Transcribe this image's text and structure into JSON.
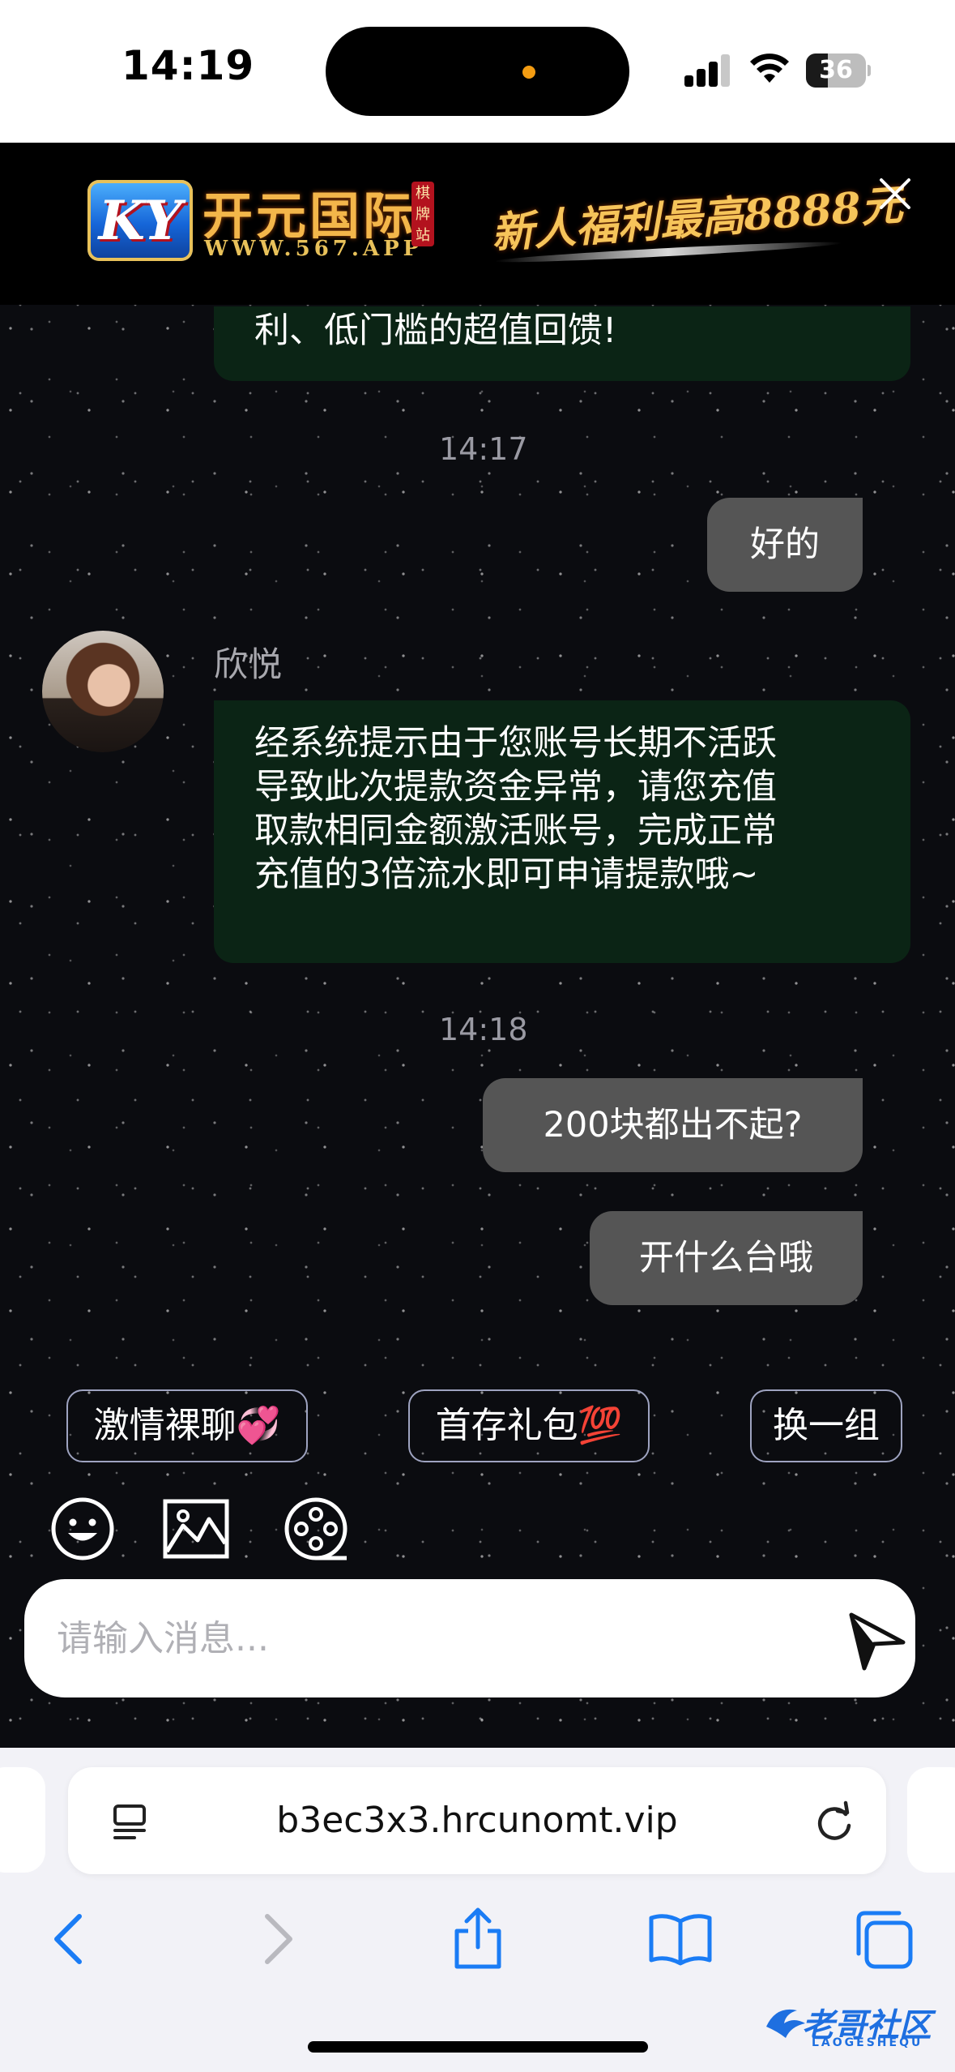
{
  "status_bar": {
    "time": "14:19",
    "battery": "36",
    "battery_level": 0.36
  },
  "ad": {
    "logo": "KY",
    "brand": "开元国际",
    "url": "WWW.567.APP",
    "tag": "棋牌站",
    "promo": "新人福利最高8888元"
  },
  "messages": [
    {
      "type": "incoming",
      "text": "利、低门槛的超值回馈!"
    },
    {
      "type": "timestamp",
      "text": "14:17"
    },
    {
      "type": "outgoing",
      "text": "好的"
    },
    {
      "type": "incoming",
      "sender": "欣悦",
      "lines": [
        "经系统提示由于您账号长期不活跃",
        "导致此次提款资金异常，请您充值",
        "取款相同金额激活账号，完成正常",
        "充值的3倍流水即可申请提款哦~"
      ]
    },
    {
      "type": "timestamp",
      "text": "14:18"
    },
    {
      "type": "outgoing",
      "text": "200块都出不起?"
    },
    {
      "type": "outgoing",
      "text": "开什么台哦"
    }
  ],
  "quick_replies": [
    "激情裸聊💞",
    "首存礼包💯",
    "换一组"
  ],
  "input": {
    "placeholder": "请输入消息..."
  },
  "browser": {
    "url": "b3ec3x3.hrcunomt.vip"
  },
  "watermark": {
    "text": "老哥社区",
    "sub": "LAOGESHEQU"
  },
  "colors": {
    "incoming_bubble": "#0b2415",
    "outgoing_bubble": "#555555",
    "chat_bg": "#0b0c10"
  }
}
